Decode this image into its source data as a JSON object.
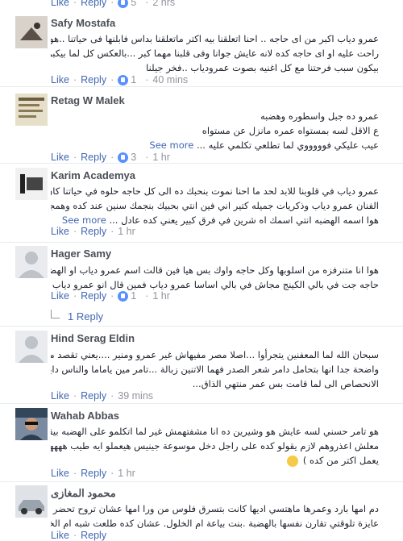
{
  "labels": {
    "like": "Like",
    "reply": "Reply",
    "see_more": "See more",
    "sep": "·"
  },
  "top_stub": {
    "count": "5",
    "time": "2 hrs"
  },
  "comments": [
    {
      "name": "Safy Mostafa",
      "lines": [
        "عمرو دياب اكبر من اى حاجه .. احنا اتعلقنا بيه اكتر ماتعلقنا بداس فابلنها فى حياتنا ..هوا مستحيل يتقال عليه",
        "راحت عليه او اى حاجه كده لانه عايش جوانا وفى قلبنا مهما كبر ...بالعكس كل لما بيكبر كل مابيسعدنا و",
        "بيكون سبب فرحتنا مع كل اغنيه بصوت عمرودياب ..فخر جيلنا"
      ],
      "count": "1",
      "time": "40 mins"
    },
    {
      "name": "Retag W Malek",
      "lines": [
        "عمرو ده جبل واسطوره وهضبه",
        "ع الاقل لسه بمستواه عمره مانزل عن مستواه",
        "عيب عليكي فوووووي لما تطلعي تكلمي عليه ..."
      ],
      "count": "3",
      "time": "1 hr"
    },
    {
      "name": "Karim Academya",
      "lines": [
        "عمرو دياب في قلوبنا للابد لحد ما احنا نموت بنحبك ده الى كل حاجه حلوه في حياتنا كان ليها اغنيه حلوه من",
        "الفنان عمرو دياب وذكريات جميله كتير اني فين انتي بحبيك بنجمك سنين عند كده وهمجبيش ربع عمرو دياب",
        "هوا اسمه الهضبه انتي اسمك اه شرين في فرق كبير يعني كده عادل ..."
      ],
      "time": "1 hr"
    },
    {
      "name": "Hager Samy",
      "lines": [
        "هوا انا متنرفزه من اسلوبها وكل حاجه واوك بس هيا فين قالت اسم عمرو دياب او الهضبه ??? !!!انا اول",
        "حاجه جت في بالي الكينج مجاش في بالي اساسا عمرو دياب فمين قال انو عمرو دياب لمؤاخذه يعني !!!!"
      ],
      "count": "1",
      "time": "1 hr",
      "reply_label": "1 Reply"
    },
    {
      "name": "Hind Serag Eldin",
      "lines": [
        "سبحان الله لما المعفنين يتجرأوا ...اصلا مصر مفيهاش غير عمرو ومنير ....يعني تقصد مين فيهم ...وان كانت",
        "واضحة جدا انها بتحامل دامر شعر الصدر فهما الاتنين زبالة ...تامر مين ياماما والناس دايمين ...زمن",
        "الانحصاص الى لما قامت بس عمر منتهي الذاق..."
      ],
      "time": "39 mins"
    },
    {
      "name": "Wahab Abbas",
      "lines": [
        "هو تامر حسني لسه عايش هو وشيرين ده انا مشفتهمش غير لما اتكلمو على الهضبه بيقع كده هههههه",
        "معلش اعذروهم لازم يقولو كده على راجل دخل موسوعة جينيس هيعملو ايه طيب ههههه ( الاندثار والاختفاء",
        "يعمل اكتر من كده )"
      ],
      "time": "1 hr"
    },
    {
      "name": "محمود المغازى",
      "lines": [
        "دم امها بارد وعمرها ماهتسي اديها كانت بتسرق فلوس من ورا امها عشان تروح تحضر حفلة للهضبة.",
        "عايزة تلوقتي تقارن نفسها بالهضبة .بنت بياعة ام الخلول. عشان كده طلعت شبه ام الخلول"
      ]
    }
  ]
}
